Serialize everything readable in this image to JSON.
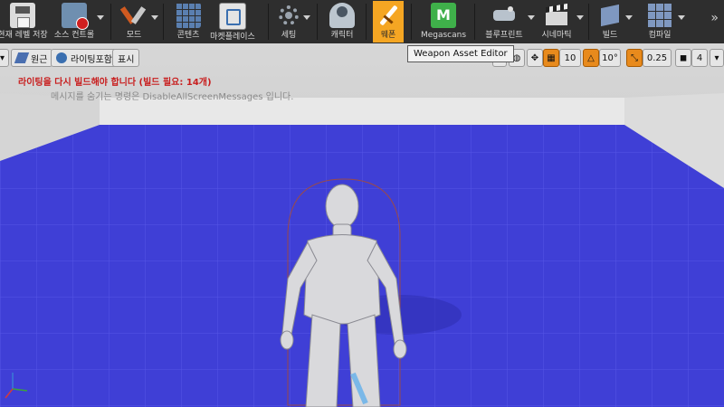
{
  "toolbar": {
    "items": [
      {
        "label": "현재 레벨 저장",
        "icon": "save-icon"
      },
      {
        "label": "소스 컨트롤",
        "icon": "source-control-icon"
      },
      {
        "label": "모드",
        "icon": "modes-icon"
      },
      {
        "label": "콘텐츠",
        "icon": "content-icon"
      },
      {
        "label": "마켓플레이스",
        "icon": "marketplace-icon"
      },
      {
        "label": "세팅",
        "icon": "settings-icon"
      },
      {
        "label": "캐릭터",
        "icon": "character-icon"
      },
      {
        "label": "웨폰",
        "icon": "weapon-icon"
      },
      {
        "label": "Megascans",
        "icon": "megascans-icon"
      },
      {
        "label": "블루프린트",
        "icon": "blueprint-icon"
      },
      {
        "label": "시네마틱",
        "icon": "cinematics-icon"
      },
      {
        "label": "빌드",
        "icon": "build-icon"
      },
      {
        "label": "컴파일",
        "icon": "compile-icon"
      }
    ],
    "overflow": "»",
    "active_color": "#f5a623"
  },
  "tooltip": "Weapon Asset Editor",
  "viewport": {
    "perspective": "원근",
    "lit": "라이팅포함",
    "show": "표시",
    "grid_snap": "10",
    "rot_snap": "10°",
    "scale_snap": "0.25",
    "camera_speed": "4",
    "warning": "라이팅을 다시 빌드해야 합니다 (빌드 필요: 14개)",
    "info": "메시지를 숨기는 명령은 DisableAllScreenMessages 입니다.",
    "floor_color": "#3f3fd6",
    "wall_color": "#e4e4e4"
  }
}
